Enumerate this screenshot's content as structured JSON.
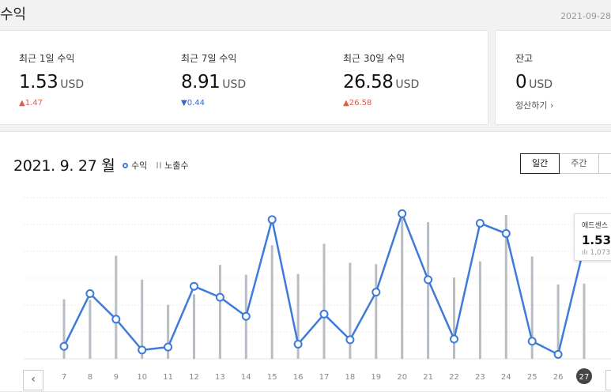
{
  "header": {
    "title": "수익",
    "date": "2021-09-28"
  },
  "stats": [
    {
      "label": "최근 1일 수익",
      "value": "1.53",
      "unit": "USD",
      "delta": "1.47",
      "trend": "up"
    },
    {
      "label": "최근 7일 수익",
      "value": "8.91",
      "unit": "USD",
      "delta": "0.44",
      "trend": "down"
    },
    {
      "label": "최근 30일 수익",
      "value": "26.58",
      "unit": "USD",
      "delta": "26.58",
      "trend": "up"
    }
  ],
  "balance": {
    "label": "잔고",
    "value": "0",
    "unit": "USD",
    "action": "정산하기"
  },
  "chart_header": {
    "date": "2021. 9. 27 월",
    "legend": [
      "수익",
      "노출수"
    ],
    "tabs": [
      "일간",
      "주간",
      ""
    ]
  },
  "tooltip": {
    "label": "애드센스",
    "value": "1.53",
    "sub": "1,073"
  },
  "colors": {
    "line": "#3e7bd8",
    "bar": "#b8bdc4",
    "up": "#e05a4a",
    "down": "#3a64c8"
  },
  "chart_data": {
    "type": "line",
    "categories": [
      "7",
      "8",
      "9",
      "10",
      "11",
      "12",
      "13",
      "14",
      "15",
      "16",
      "17",
      "18",
      "19",
      "20",
      "21",
      "22",
      "23",
      "24",
      "25",
      "26",
      "27"
    ],
    "series": [
      {
        "name": "수익",
        "type": "line",
        "values": [
          0.17,
          0.89,
          0.54,
          0.12,
          0.16,
          0.99,
          0.84,
          0.58,
          1.9,
          0.2,
          0.61,
          0.26,
          0.91,
          1.98,
          1.08,
          0.27,
          1.85,
          1.71,
          0.24,
          0.06,
          1.53
        ]
      },
      {
        "name": "노출수",
        "type": "bar",
        "values": [
          850,
          840,
          1470,
          1130,
          770,
          920,
          1340,
          1200,
          1620,
          1210,
          1640,
          1370,
          1350,
          2030,
          1950,
          1160,
          1390,
          2050,
          1460,
          1060,
          1073
        ]
      }
    ],
    "selected": "27"
  }
}
